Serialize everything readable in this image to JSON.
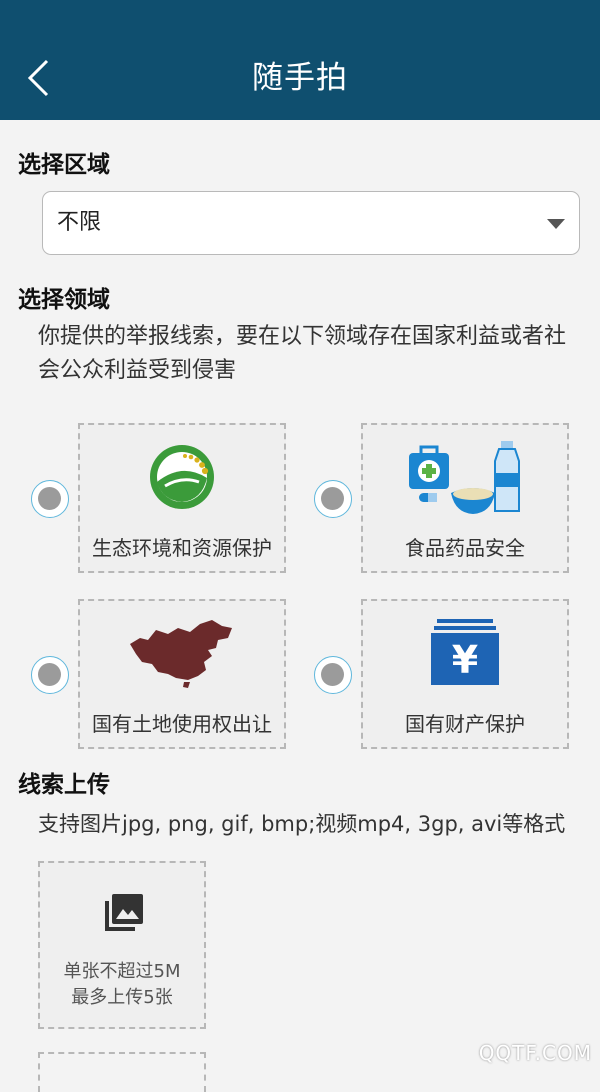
{
  "header": {
    "title": "随手拍",
    "back_icon": "chevron-left-icon"
  },
  "region": {
    "title": "选择区域",
    "selected": "不限"
  },
  "field": {
    "title": "选择领域",
    "description": "你提供的举报线索，要在以下领域存在国家利益或者社会公众利益受到侵害",
    "options": [
      {
        "label": "生态环境和资源保护",
        "icon": "ecology-leaf-icon"
      },
      {
        "label": "食品药品安全",
        "icon": "food-drug-icon"
      },
      {
        "label": "国有土地使用权出让",
        "icon": "china-map-icon"
      },
      {
        "label": "国有财产保护",
        "icon": "yuan-asset-icon"
      }
    ]
  },
  "upload": {
    "title": "线索上传",
    "hint": "支持图片jpg, png, gif, bmp;视频mp4, 3gp, avi等格式",
    "box_line1": "单张不超过5M",
    "box_line2": "最多上传5张",
    "icon": "photo-library-icon"
  },
  "watermark": "QQTF.COM",
  "colors": {
    "header_bg": "#0f4f6f",
    "radio_border": "#5fb7dc",
    "map_fill": "#6b2a2b",
    "asset_blue": "#1e64b4",
    "eco_green": "#3b9b3a"
  }
}
